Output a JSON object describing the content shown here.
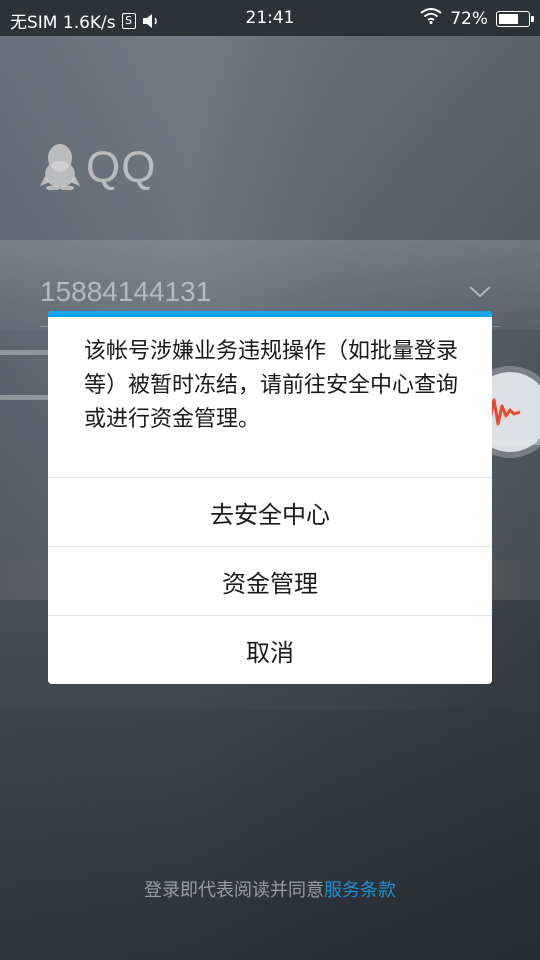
{
  "status_bar": {
    "carrier": "无SIM 1.6K/s",
    "time": "21:41",
    "battery": "72%",
    "battery_level": 0.72
  },
  "app": {
    "logo_text": "QQ",
    "account_number": "15884144131"
  },
  "dialog": {
    "message": "该帐号涉嫌业务违规操作（如批量登录等）被暂时冻结，请前往安全中心查询或进行资金管理。",
    "buttons": [
      {
        "label": "去安全中心"
      },
      {
        "label": "资金管理"
      },
      {
        "label": "取消"
      }
    ],
    "accent_color": "#13a5e8"
  },
  "footer": {
    "text": "登录即代表阅读并同意",
    "link": "服务条款"
  },
  "colors": {
    "status_bar_bg": "#2d3238",
    "link": "#1e8fd0",
    "voice_icon": "#e84a2b"
  }
}
